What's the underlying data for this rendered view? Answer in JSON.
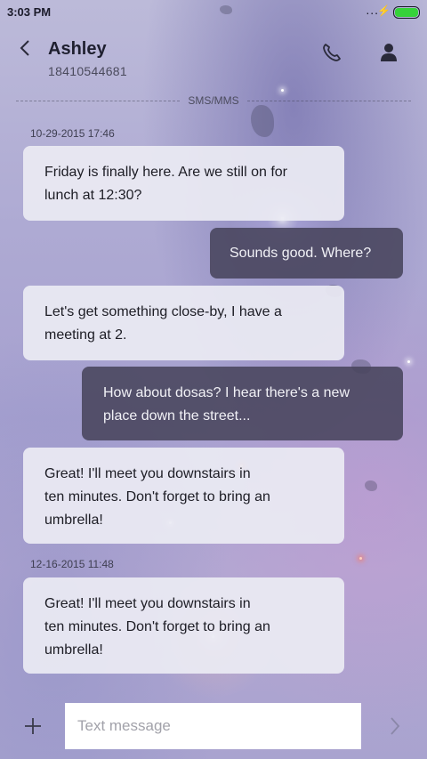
{
  "status_bar": {
    "time": "3:03 PM",
    "signal": "...",
    "charging_symbol": "⚡",
    "battery_level": 1.0,
    "battery_color": "#36d23a"
  },
  "header": {
    "back_icon": "back-chevron-icon",
    "contact_name": "Ashley",
    "contact_number": "18410544681",
    "call_icon": "phone-icon",
    "profile_icon": "person-icon"
  },
  "channel_label": "SMS/MMS",
  "conversation": [
    {
      "type": "timestamp",
      "text": "10-29-2015 17:46"
    },
    {
      "type": "message",
      "direction": "incoming",
      "lines": [
        "Friday is finally here. Are we still on for",
        "lunch at 12:30?"
      ]
    },
    {
      "type": "message",
      "direction": "outgoing",
      "lines": [
        "Sounds good. Where?"
      ]
    },
    {
      "type": "message",
      "direction": "incoming",
      "lines": [
        "Let's get something close-by, I have a",
        "meeting at 2."
      ]
    },
    {
      "type": "message",
      "direction": "outgoing",
      "lines": [
        "How about dosas? I hear there's a new",
        "place down the street..."
      ]
    },
    {
      "type": "message",
      "direction": "incoming",
      "lines": [
        "Great! I'll meet you downstairs in",
        "ten minutes. Don't forget to bring an",
        "umbrella!"
      ]
    },
    {
      "type": "timestamp",
      "text": "12-16-2015 11:48"
    },
    {
      "type": "message",
      "direction": "incoming",
      "lines": [
        "Great! I'll meet you downstairs in",
        "ten minutes. Don't forget to bring an",
        "umbrella!"
      ]
    }
  ],
  "composer": {
    "add_icon": "plus-icon",
    "placeholder": "Text message",
    "value": "",
    "send_icon": "send-chevron-icon"
  },
  "colors": {
    "incoming_bubble": "#ebebf3",
    "outgoing_bubble": "#48445c",
    "accent_battery": "#36d23a"
  }
}
